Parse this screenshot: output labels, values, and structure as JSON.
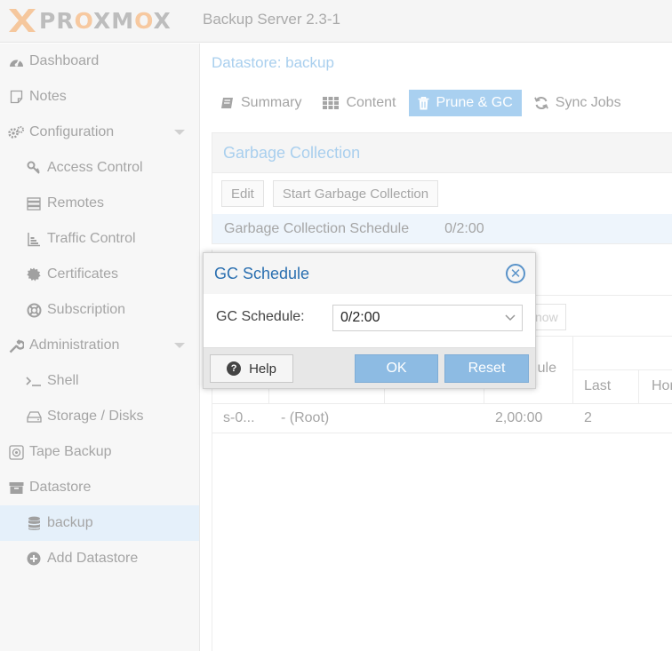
{
  "header": {
    "logo_text": "PROXMOX",
    "version": "Backup Server 2.3-1"
  },
  "sidebar": {
    "items": [
      {
        "label": "Dashboard",
        "icon": "dashboard-icon"
      },
      {
        "label": "Notes",
        "icon": "notes-icon"
      },
      {
        "label": "Configuration",
        "icon": "gears-icon",
        "expanded": true
      },
      {
        "label": "Access Control",
        "icon": "key-icon"
      },
      {
        "label": "Remotes",
        "icon": "server-icon"
      },
      {
        "label": "Traffic Control",
        "icon": "traffic-icon"
      },
      {
        "label": "Certificates",
        "icon": "certificate-icon"
      },
      {
        "label": "Subscription",
        "icon": "lifebuoy-icon"
      },
      {
        "label": "Administration",
        "icon": "wrench-icon",
        "expanded": true
      },
      {
        "label": "Shell",
        "icon": "terminal-icon"
      },
      {
        "label": "Storage / Disks",
        "icon": "hdd-icon"
      },
      {
        "label": "Tape Backup",
        "icon": "tape-icon"
      },
      {
        "label": "Datastore",
        "icon": "archive-icon"
      },
      {
        "label": "backup",
        "icon": "database-icon",
        "active": true
      },
      {
        "label": "Add Datastore",
        "icon": "plus-circle-icon"
      }
    ]
  },
  "main": {
    "title": "Datastore: backup",
    "tabs": [
      {
        "label": "Summary",
        "icon": "book-icon"
      },
      {
        "label": "Content",
        "icon": "grid-icon"
      },
      {
        "label": "Prune & GC",
        "icon": "trash-icon",
        "active": true
      },
      {
        "label": "Sync Jobs",
        "icon": "refresh-icon"
      }
    ],
    "gc": {
      "title": "Garbage Collection",
      "edit_label": "Edit",
      "start_label": "Start Garbage Collection",
      "schedule_key": "Garbage Collection Schedule",
      "schedule_value": "0/2:00"
    },
    "prune": {
      "run_now_label": "now",
      "col_schedule_fragment": "ule",
      "col_last": "Last",
      "col_ho": "Hor",
      "row": {
        "id": "s-0...",
        "namespace": "- (Root)",
        "schedule": "2,00:00",
        "last": "2"
      }
    }
  },
  "dialog": {
    "title": "GC Schedule",
    "field_label": "GC Schedule:",
    "field_value": "0/2:00",
    "help_label": "Help",
    "ok_label": "OK",
    "reset_label": "Reset"
  },
  "colors": {
    "accent": "#2a6fb0",
    "active_tab": "#a9d0f0",
    "primary_button": "#8dbbe3",
    "brand_orange": "#e57000"
  }
}
